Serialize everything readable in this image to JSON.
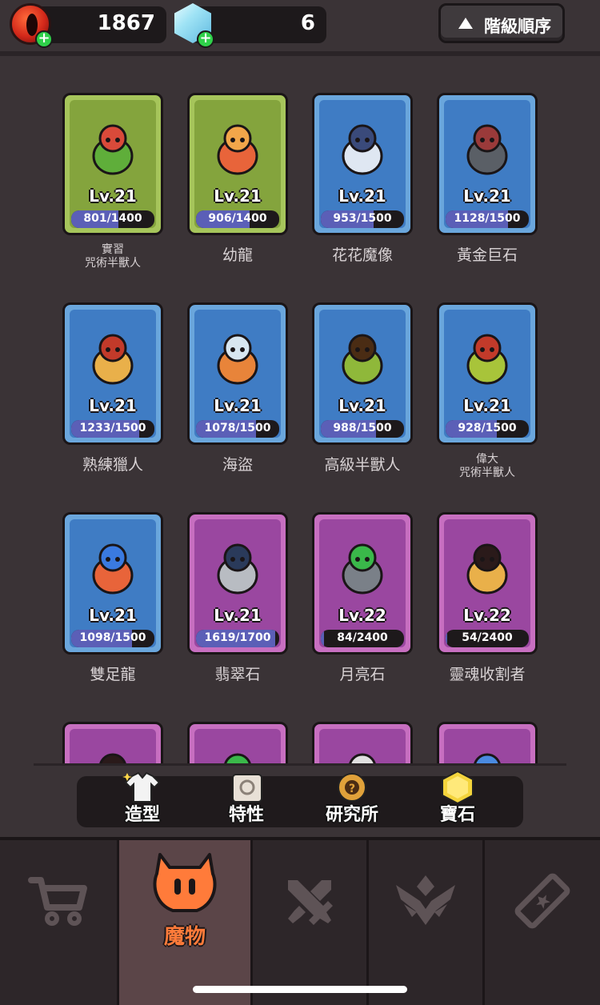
{
  "resources": {
    "red_gem": {
      "icon": "red-orb-icon",
      "value": "1867"
    },
    "blue_gem": {
      "icon": "crystal-icon",
      "value": "6"
    },
    "add_symbol": "+"
  },
  "sort_button": {
    "icon": "triangle-up-icon",
    "label": "階級順序"
  },
  "cards": [
    {
      "rarity": "green",
      "level": "Lv.21",
      "xp": "801/1400",
      "progress": 0.572,
      "name": "實習\n咒術半獸人"
    },
    {
      "rarity": "green",
      "level": "Lv.21",
      "xp": "906/1400",
      "progress": 0.647,
      "name": "幼龍"
    },
    {
      "rarity": "blue",
      "level": "Lv.21",
      "xp": "953/1500",
      "progress": 0.635,
      "name": "花花魔像"
    },
    {
      "rarity": "blue",
      "level": "Lv.21",
      "xp": "1128/1500",
      "progress": 0.752,
      "name": "黃金巨石"
    },
    {
      "rarity": "blue",
      "level": "Lv.21",
      "xp": "1233/1500",
      "progress": 0.822,
      "name": "熟練獵人"
    },
    {
      "rarity": "blue",
      "level": "Lv.21",
      "xp": "1078/1500",
      "progress": 0.719,
      "name": "海盜"
    },
    {
      "rarity": "blue",
      "level": "Lv.21",
      "xp": "988/1500",
      "progress": 0.659,
      "name": "高級半獸人"
    },
    {
      "rarity": "blue",
      "level": "Lv.21",
      "xp": "928/1500",
      "progress": 0.619,
      "name": "偉大\n咒術半獸人"
    },
    {
      "rarity": "blue",
      "level": "Lv.21",
      "xp": "1098/1500",
      "progress": 0.732,
      "name": "雙足龍"
    },
    {
      "rarity": "purple",
      "level": "Lv.21",
      "xp": "1619/1700",
      "progress": 0.952,
      "name": "翡翠石"
    },
    {
      "rarity": "purple",
      "level": "Lv.22",
      "xp": "84/2400",
      "progress": 0.035,
      "name": "月亮石"
    },
    {
      "rarity": "purple",
      "level": "Lv.22",
      "xp": "54/2400",
      "progress": 0.023,
      "name": "靈魂收割者"
    },
    {
      "rarity": "purple",
      "level": "",
      "xp": "",
      "progress": 0,
      "name": ""
    },
    {
      "rarity": "purple",
      "level": "",
      "xp": "",
      "progress": 0,
      "name": ""
    },
    {
      "rarity": "purple",
      "level": "",
      "xp": "",
      "progress": 0,
      "name": ""
    },
    {
      "rarity": "purple",
      "level": "",
      "xp": "",
      "progress": 0,
      "name": ""
    }
  ],
  "sub_tabs": [
    {
      "icon": "shirt-icon",
      "label": "造型"
    },
    {
      "icon": "scroll-icon",
      "label": "特性"
    },
    {
      "icon": "research-gear-icon",
      "label": "研究所"
    },
    {
      "icon": "gem-icon",
      "label": "寶石"
    }
  ],
  "nav": [
    {
      "icon": "cart-icon",
      "label": ""
    },
    {
      "icon": "monster-icon",
      "label": "魔物",
      "active": true
    },
    {
      "icon": "swords-icon",
      "label": ""
    },
    {
      "icon": "rank-wings-icon",
      "label": ""
    },
    {
      "icon": "ticket-icon",
      "label": ""
    }
  ],
  "colors": {
    "green_card": "#a6c55b",
    "blue_card": "#6aa6dc",
    "purple_card": "#c76fc0",
    "accent_orange": "#ff7b3a",
    "plus_green": "#2fd14a"
  }
}
